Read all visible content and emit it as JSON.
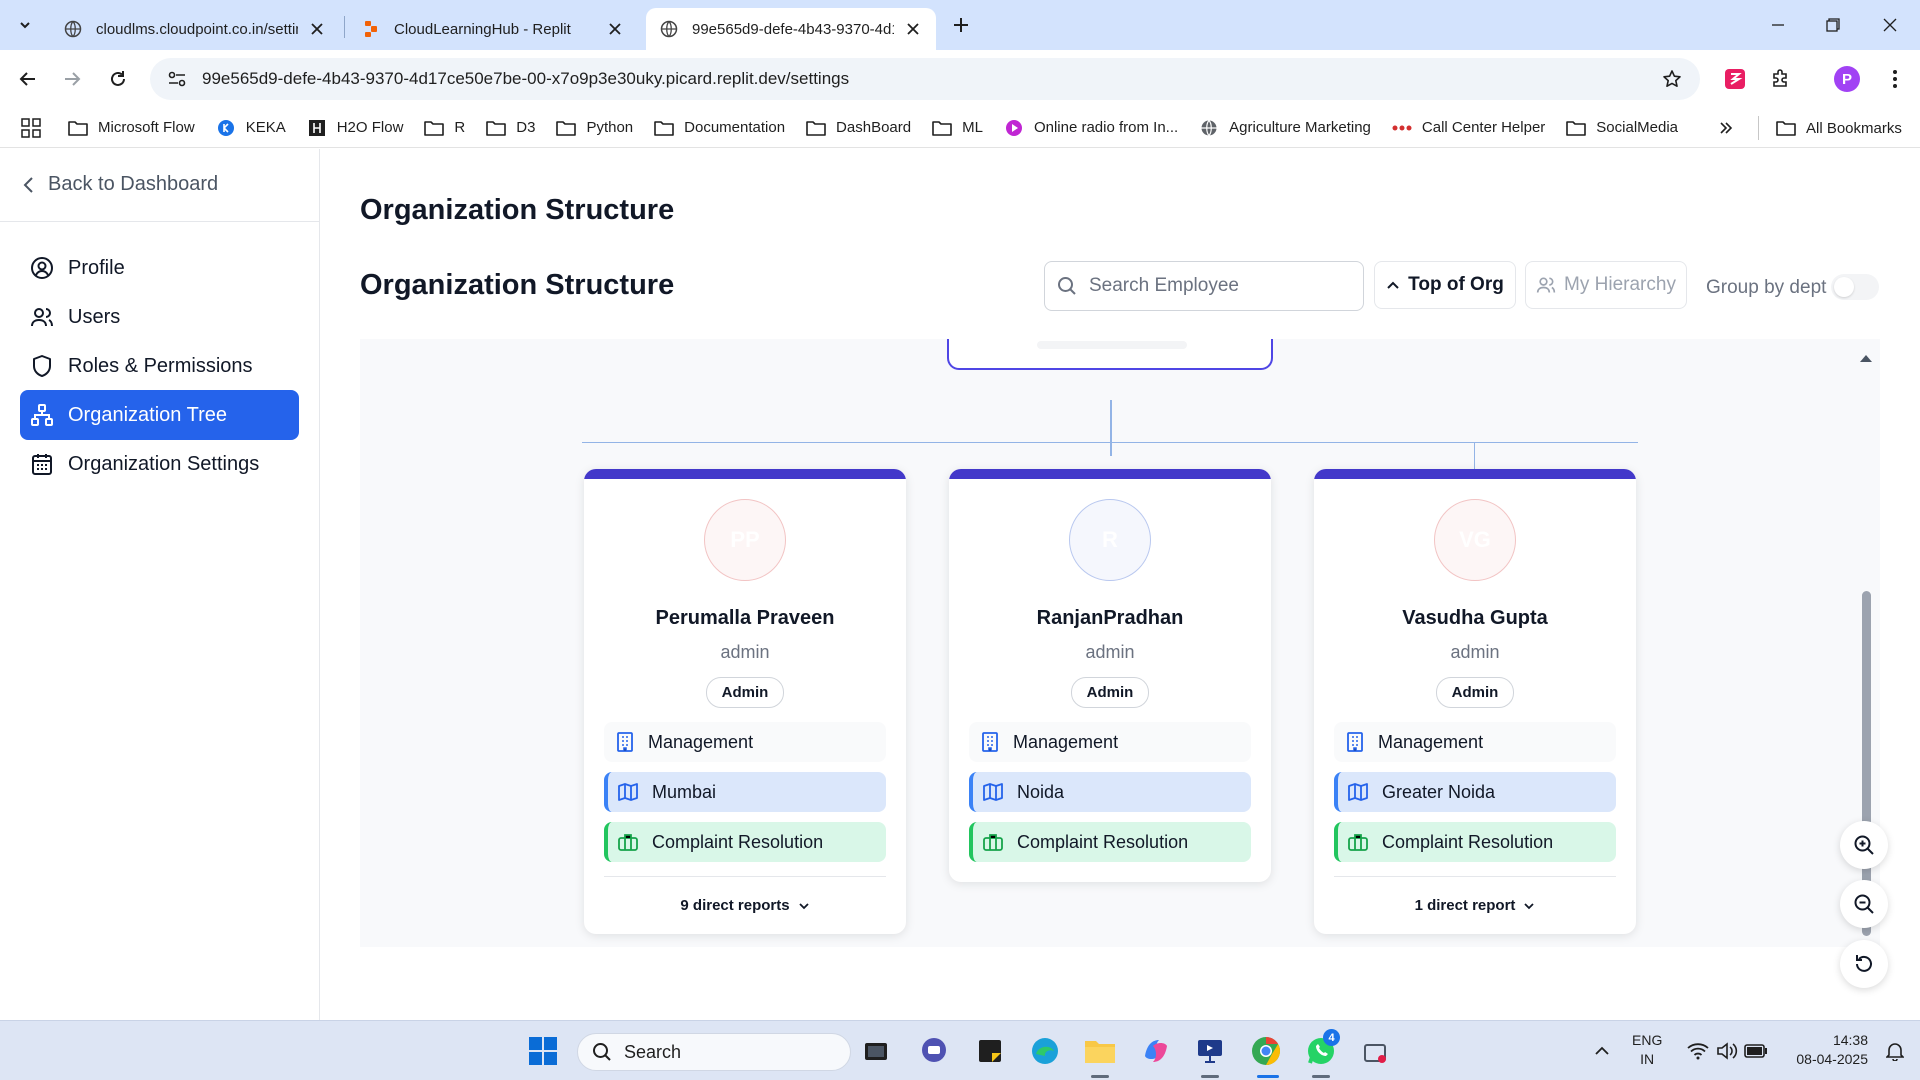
{
  "browser": {
    "tabs": [
      {
        "title": "cloudlms.cloudpoint.co.in/settin",
        "favicon": "globe-icon",
        "active": false
      },
      {
        "title": "CloudLearningHub - Replit",
        "favicon": "replit-icon",
        "active": false
      },
      {
        "title": "99e565d9-defe-4b43-9370-4d1",
        "favicon": "globe-icon",
        "active": true
      }
    ],
    "url": "99e565d9-defe-4b43-9370-4d17ce50e7be-00-x7o9p3e30uky.picard.replit.dev/settings",
    "profile_initial": "P",
    "bookmarks": [
      {
        "label": "Microsoft Flow",
        "icon": "folder-icon"
      },
      {
        "label": "KEKA",
        "icon": "keka-icon"
      },
      {
        "label": "H2O Flow",
        "icon": "h2o-icon"
      },
      {
        "label": "R",
        "icon": "folder-icon"
      },
      {
        "label": "D3",
        "icon": "folder-icon"
      },
      {
        "label": "Python",
        "icon": "folder-icon"
      },
      {
        "label": "Documentation",
        "icon": "folder-icon"
      },
      {
        "label": "DashBoard",
        "icon": "folder-icon"
      },
      {
        "label": "ML",
        "icon": "folder-icon"
      },
      {
        "label": "Online radio from In...",
        "icon": "radio-icon"
      },
      {
        "label": "Agriculture Marketing",
        "icon": "globe-icon"
      },
      {
        "label": "Call Center Helper",
        "icon": "dots-icon"
      },
      {
        "label": "SocialMedia",
        "icon": "folder-icon"
      }
    ],
    "all_bookmarks": "All Bookmarks"
  },
  "sidebar": {
    "back_label": "Back to Dashboard",
    "items": [
      {
        "label": "Profile",
        "icon": "user-circle-icon",
        "active": false
      },
      {
        "label": "Users",
        "icon": "users-icon",
        "active": false
      },
      {
        "label": "Roles & Permissions",
        "icon": "shield-icon",
        "active": false
      },
      {
        "label": "Organization Tree",
        "icon": "org-tree-icon",
        "active": true
      },
      {
        "label": "Organization Settings",
        "icon": "calendar-icon",
        "active": false
      }
    ]
  },
  "main": {
    "page_title": "Organization Structure",
    "section_title": "Organization Structure",
    "search_placeholder": "Search Employee",
    "top_of_org_label": "Top of Org",
    "my_hierarchy_label": "My Hierarchy",
    "group_by_dept_label": "Group by dept",
    "group_by_dept_on": false
  },
  "employees": [
    {
      "initials": "PP",
      "name": "Perumalla Praveen",
      "role": "admin",
      "badge": "Admin",
      "department": "Management",
      "location": "Mumbai",
      "team": "Complaint Resolution",
      "reports": "9 direct reports"
    },
    {
      "initials": "R",
      "name": "RanjanPradhan",
      "role": "admin",
      "badge": "Admin",
      "department": "Management",
      "location": "Noida",
      "team": "Complaint Resolution",
      "reports": ""
    },
    {
      "initials": "VG",
      "name": "Vasudha Gupta",
      "role": "admin",
      "badge": "Admin",
      "department": "Management",
      "location": "Greater Noida",
      "team": "Complaint Resolution",
      "reports": "1 direct report"
    }
  ],
  "taskbar": {
    "search_label": "Search",
    "whatsapp_badge": "4",
    "lang_line1": "ENG",
    "lang_line2": "IN",
    "time": "14:38",
    "date": "08-04-2025"
  },
  "colors": {
    "primary": "#2563eb",
    "card_accent": "#4338ca",
    "location_bg": "#dbe7fb",
    "team_bg": "#d9f7e8"
  }
}
